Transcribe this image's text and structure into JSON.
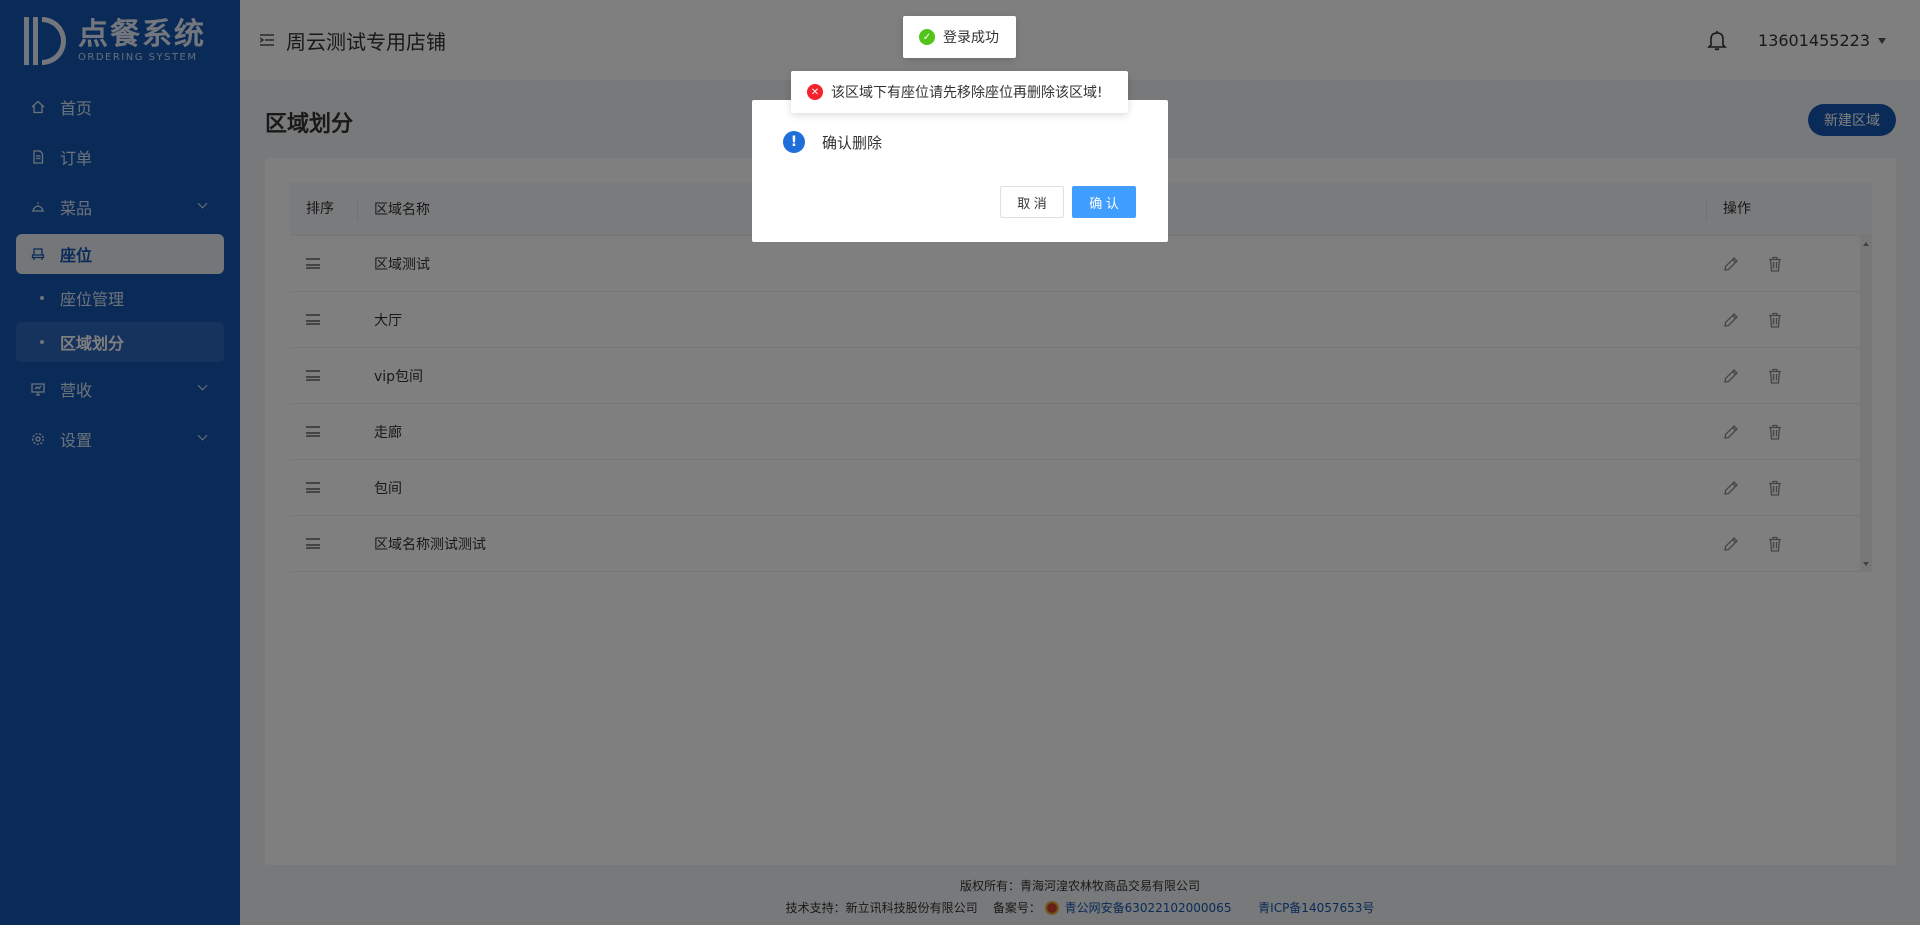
{
  "logo": {
    "cn": "点餐系统",
    "en": "ORDERING SYSTEM"
  },
  "sidebar": {
    "items": [
      {
        "label": "首页",
        "icon": "home-icon"
      },
      {
        "label": "订单",
        "icon": "document-icon"
      },
      {
        "label": "菜品",
        "icon": "dish-icon"
      },
      {
        "label": "座位",
        "icon": "seat-icon"
      },
      {
        "label": "座位管理"
      },
      {
        "label": "区域划分"
      },
      {
        "label": "营收",
        "icon": "monitor-icon"
      },
      {
        "label": "设置",
        "icon": "gear-icon"
      }
    ]
  },
  "header": {
    "shop_name": "周云测试专用店铺",
    "user": "13601455223"
  },
  "main": {
    "title": "区域划分",
    "new_button": "新建区域",
    "table": {
      "headers": [
        "排序",
        "区域名称",
        "操作"
      ],
      "rows": [
        "区域测试",
        "大厅",
        "vip包间",
        "走廊",
        "包间",
        "区域名称测试测试"
      ]
    }
  },
  "footer": {
    "line1": "版权所有：青海河湟农林牧商品交易有限公司",
    "support": "技术支持：新立讯科技股份有限公司",
    "record_label": "备案号：",
    "police_record": "青公网安备63022102000065",
    "icp": "青ICP备14057653号"
  },
  "dialog": {
    "message": "确认删除",
    "cancel": "取 消",
    "confirm": "确 认"
  },
  "toasts": {
    "success": "登录成功",
    "error": "该区域下有座位请先移除座位再删除该区域!"
  },
  "colors": {
    "primary": "#1557b0",
    "confirm": "#409eff",
    "success": "#52c41a",
    "error": "#f5222d"
  }
}
